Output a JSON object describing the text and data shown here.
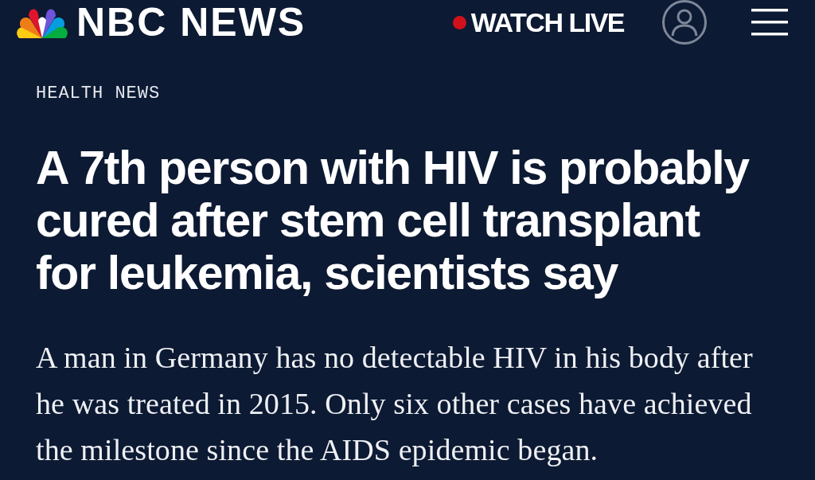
{
  "header": {
    "logo_text": "NBC NEWS",
    "watch_live": "WATCH LIVE"
  },
  "article": {
    "section": "HEALTH NEWS",
    "headline": "A 7th person with HIV is probably cured after stem cell transplant for leukemia, scientists say",
    "dek": "A man in Germany has no detectable HIV in his body after he was treated in 2015. Only six other cases have achieved the milestone since the AIDS epidemic began."
  }
}
